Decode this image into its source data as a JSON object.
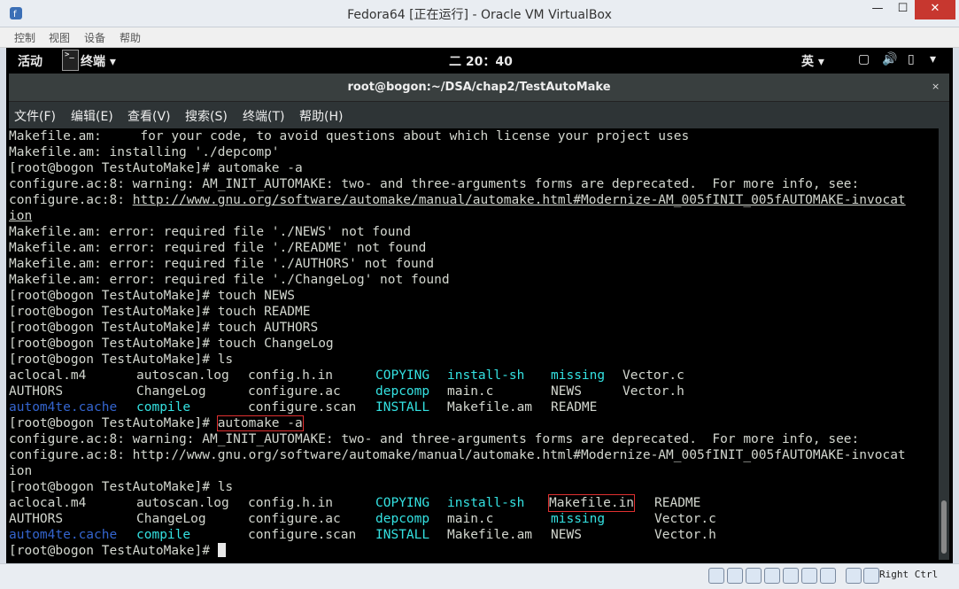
{
  "window": {
    "title": "Fedora64 [正在运行] - Oracle VM VirtualBox",
    "controls": {
      "minimize": "—",
      "maximize": "☐",
      "close": "✕"
    }
  },
  "vm_menu": [
    "控制",
    "视图",
    "设备",
    "帮助"
  ],
  "gnome": {
    "activities": "活动",
    "app_label": "终端 ▾",
    "clock": "二 20：40",
    "input_method": "英 ▾"
  },
  "terminal": {
    "title": "root@bogon:~/DSA/chap2/TestAutoMake",
    "close": "×",
    "menu": [
      "文件(F)",
      "编辑(E)",
      "查看(V)",
      "搜索(S)",
      "终端(T)",
      "帮助(H)"
    ]
  },
  "lines": [
    "Makefile.am:     for your code, to avoid questions about which license your project uses",
    "Makefile.am: installing './depcomp'",
    "[root@bogon TestAutoMake]# automake -a",
    "configure.ac:8: warning: AM_INIT_AUTOMAKE: two- and three-arguments forms are deprecated.  For more info, see:",
    "configure.ac:8: ",
    "ion",
    "Makefile.am: error: required file './NEWS' not found",
    "Makefile.am: error: required file './README' not found",
    "Makefile.am: error: required file './AUTHORS' not found",
    "Makefile.am: error: required file './ChangeLog' not found",
    "[root@bogon TestAutoMake]# touch NEWS",
    "[root@bogon TestAutoMake]# touch README",
    "[root@bogon TestAutoMake]# touch AUTHORS",
    "[root@bogon TestAutoMake]# touch ChangeLog",
    "[root@bogon TestAutoMake]# ls",
    "",
    "",
    "",
    "[root@bogon TestAutoMake]# ",
    "configure.ac:8: warning: AM_INIT_AUTOMAKE: two- and three-arguments forms are deprecated.  For more info, see:",
    "configure.ac:8: http://www.gnu.org/software/automake/manual/automake.html#Modernize-AM_005fINIT_005fAUTOMAKE-invocat",
    "ion",
    "[root@bogon TestAutoMake]# ls",
    "",
    "",
    "",
    "[root@bogon TestAutoMake]# "
  ],
  "link1": "http://www.gnu.org/software/automake/manual/automake.html#Modernize-AM_005fINIT_005fAUTOMAKE-invocat",
  "cmd_highlight": "automake -a",
  "ls1": [
    [
      "aclocal.m4",
      "autoscan.log",
      "config.h.in",
      "COPYING",
      "install-sh",
      "missing",
      "Vector.c"
    ],
    [
      "AUTHORS",
      "ChangeLog",
      "configure.ac",
      "depcomp",
      "main.c",
      "NEWS",
      "Vector.h"
    ],
    [
      "autom4te.cache",
      "compile",
      "configure.scan",
      "INSTALL",
      "Makefile.am",
      "README",
      ""
    ]
  ],
  "ls2": [
    [
      "aclocal.m4",
      "autoscan.log",
      "config.h.in",
      "COPYING",
      "install-sh",
      "Makefile.in",
      "README"
    ],
    [
      "AUTHORS",
      "ChangeLog",
      "configure.ac",
      "depcomp",
      "main.c",
      "missing",
      "Vector.c"
    ],
    [
      "autom4te.cache",
      "compile",
      "configure.scan",
      "INSTALL",
      "Makefile.am",
      "NEWS",
      "Vector.h"
    ]
  ],
  "status": {
    "host_key": "Right Ctrl"
  },
  "colors": {
    "executable": "#34e2e2",
    "directory": "#3465cf",
    "text": "#d3d7cf",
    "highlight_box": "#e03030"
  }
}
